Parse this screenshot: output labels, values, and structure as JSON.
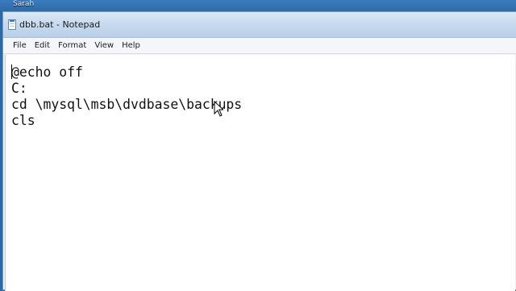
{
  "desktop": {
    "user_label": "Sarah"
  },
  "window": {
    "title": "dbb.bat - Notepad",
    "app_icon": "notepad-icon"
  },
  "menu": {
    "items": [
      "File",
      "Edit",
      "Format",
      "View",
      "Help"
    ]
  },
  "editor": {
    "lines": [
      "@echo off",
      "C:",
      "cd \\mysql\\msb\\dvdbase\\backups",
      "cls"
    ]
  },
  "cursor": {
    "icon": "mouse-pointer-icon"
  }
}
